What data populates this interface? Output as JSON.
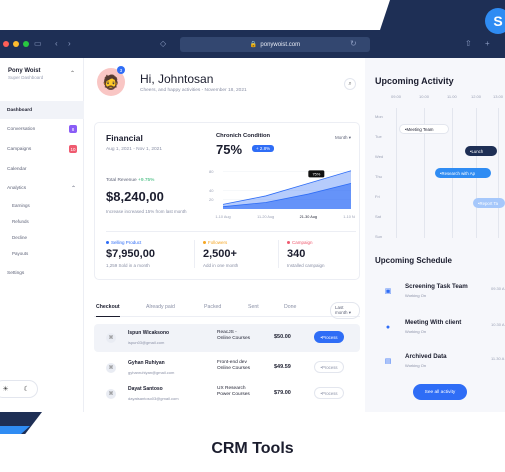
{
  "browser": {
    "url": "ponywoist.com"
  },
  "brand": {
    "name": "Pony Woist",
    "subtitle": "Super Dashboard"
  },
  "sidebar": {
    "items": [
      {
        "label": "Dashboard",
        "active": true
      },
      {
        "label": "Conversation",
        "count": "8",
        "count_color": "#8a5cf6"
      },
      {
        "label": "Campaigns",
        "count": "10",
        "count_color": "#ef5a6f"
      },
      {
        "label": "Calendar"
      },
      {
        "label": "Analytics"
      }
    ],
    "analytics_sub": [
      "Earnings",
      "Refunds",
      "Decline",
      "Payouts"
    ],
    "settings": "Settings"
  },
  "header": {
    "greeting": "Hi, Johntosan",
    "sub": "Cheers, and happy activities - November 18, 2021",
    "avatar_badge": "3"
  },
  "financial": {
    "title": "Financial",
    "range": "Aug 1, 2021 - Nov 1, 2021",
    "revenue_label": "Total Revenue",
    "revenue_change": "+9.75%",
    "revenue_value": "$8,240,00",
    "revenue_sub": "Increase increased 15% from last month"
  },
  "chronic": {
    "title": "Chronich Condition",
    "month_label": "Month",
    "percent": "75%",
    "chip": "+ 2.8%",
    "tooltip": "75%",
    "yticks": [
      "80",
      "40",
      "20"
    ],
    "xticks": [
      "1-10 Aug",
      "11-20 Aug",
      "21-30 Aug",
      "1-10 Nov"
    ]
  },
  "chart_data": {
    "type": "area",
    "x": [
      "1-10 Aug",
      "11-20 Aug",
      "21-30 Aug",
      "1-10 Nov"
    ],
    "series": [
      {
        "values": [
          10,
          28,
          55,
          82
        ]
      },
      {
        "values": [
          5,
          14,
          32,
          55
        ]
      }
    ],
    "ylim": [
      0,
      90
    ],
    "yticks": [
      20,
      40,
      80
    ],
    "color": "#2f6df6"
  },
  "kpis": [
    {
      "label": "Selling Product",
      "dot_color": "#2f6df6",
      "value": "$7,950,00",
      "sub": "1,259 Sold in a month"
    },
    {
      "label": "Followers",
      "dot_color": "#f5a623",
      "value": "2,500+",
      "sub": "Add in one month"
    },
    {
      "label": "Campaign",
      "dot_color": "#ef5a6f",
      "value": "340",
      "sub": "Installed campaign"
    }
  ],
  "tabs": [
    "Checkout",
    "Already paid",
    "Packed",
    "Sent",
    "Done"
  ],
  "tab_filter": "Last month",
  "orders": [
    {
      "name": "Ispun Wicaksono",
      "email": "ispun03@gmail.com",
      "course1": "ReacJS -",
      "course2": "Online Courses",
      "price": "$50.00",
      "status": "Process",
      "active": true
    },
    {
      "name": "Gyhan Ruhiyan",
      "email": "gyhanruhiyan@gmail.com",
      "course1": "Front-end dev",
      "course2": "Online Courses",
      "price": "$49.59",
      "status": "Process",
      "active": false
    },
    {
      "name": "Dayat Santoso",
      "email": "dayatsantoso03@gmail.com",
      "course1": "UX Research",
      "course2": "Power Courses",
      "price": "$79.00",
      "status": "Process",
      "active": false
    }
  ],
  "activity": {
    "title": "Upcoming Activity",
    "hours": [
      "09.00",
      "10.00",
      "11.00",
      "12.00",
      "13.00"
    ],
    "days": [
      "Mon",
      "Tue",
      "Wed",
      "Thu",
      "Fri",
      "Sat",
      "Sun"
    ],
    "events": [
      "Meeting Team",
      "Lunch",
      "Research with Ap",
      "Report Ta"
    ]
  },
  "schedule": {
    "title": "Upcoming Schedule",
    "items": [
      {
        "title": "Screening Task Team",
        "sub": "Working On",
        "time": "09.30 A"
      },
      {
        "title": "Meeting With client",
        "sub": "Working On",
        "time": "10.30 A"
      },
      {
        "title": "Archived Data",
        "sub": "Working On",
        "time": "11.30 A"
      }
    ],
    "see_all": "See all activity"
  },
  "caption": "CRM Tools"
}
